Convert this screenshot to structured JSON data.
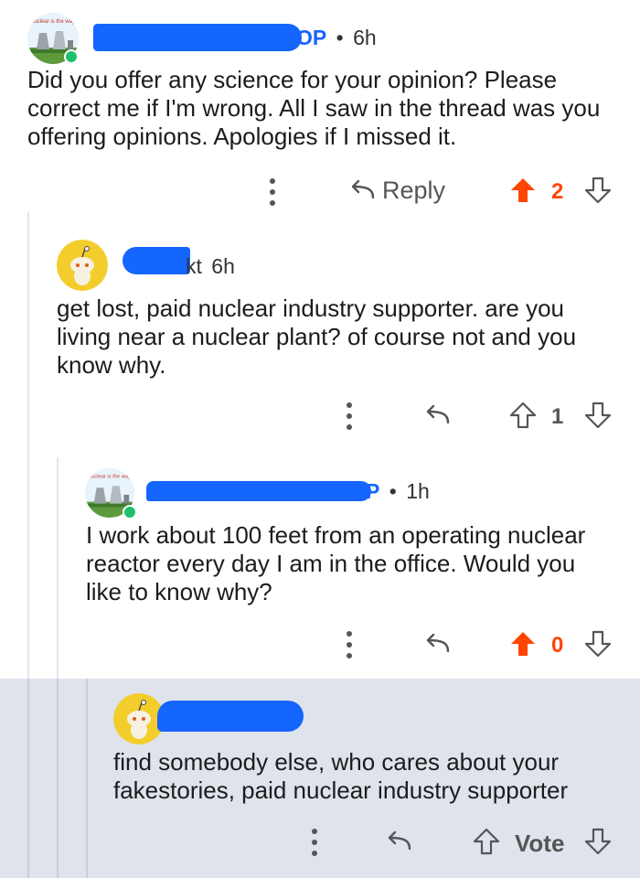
{
  "colors": {
    "upvote_active": "#ff4500",
    "online": "#1fc06c",
    "highlight": "#dee3ec",
    "redaction": "#1565ff"
  },
  "comments": [
    {
      "author_badge": "OP",
      "time_sep": "•",
      "time": "6h",
      "text": "Did you offer any science for your opinion? Please correct me if I'm wrong. All I saw in the thread was you offering opinions. Apologies if I missed it.",
      "reply_label": "Reply",
      "score": "2",
      "upvoted": true,
      "avatar_icon": "nuclear-plant-avatar",
      "avatar_caption": "nuclear is the way"
    },
    {
      "author_fragment": "kt",
      "time": "6h",
      "text": "get lost, paid nuclear industry supporter. are you living near a nuclear plant? of course not and you know why.",
      "score": "1",
      "upvoted": false,
      "avatar_icon": "snoo-avatar"
    },
    {
      "author_badge": "P",
      "time_sep": "•",
      "time": "1h",
      "text": "I work about 100 feet from an operating nuclear reactor every day I am in the office. Would you like to know why?",
      "score": "0",
      "upvoted": true,
      "avatar_icon": "nuclear-plant-avatar",
      "avatar_caption": "nuclear is the way"
    },
    {
      "text": "find somebody else, who cares about your fakestories, paid nuclear industry supporter",
      "vote_label": "Vote",
      "avatar_icon": "snoo-avatar"
    }
  ],
  "icons": [
    "more-options-icon",
    "reply-arrow-icon",
    "upvote-icon",
    "downvote-icon"
  ]
}
